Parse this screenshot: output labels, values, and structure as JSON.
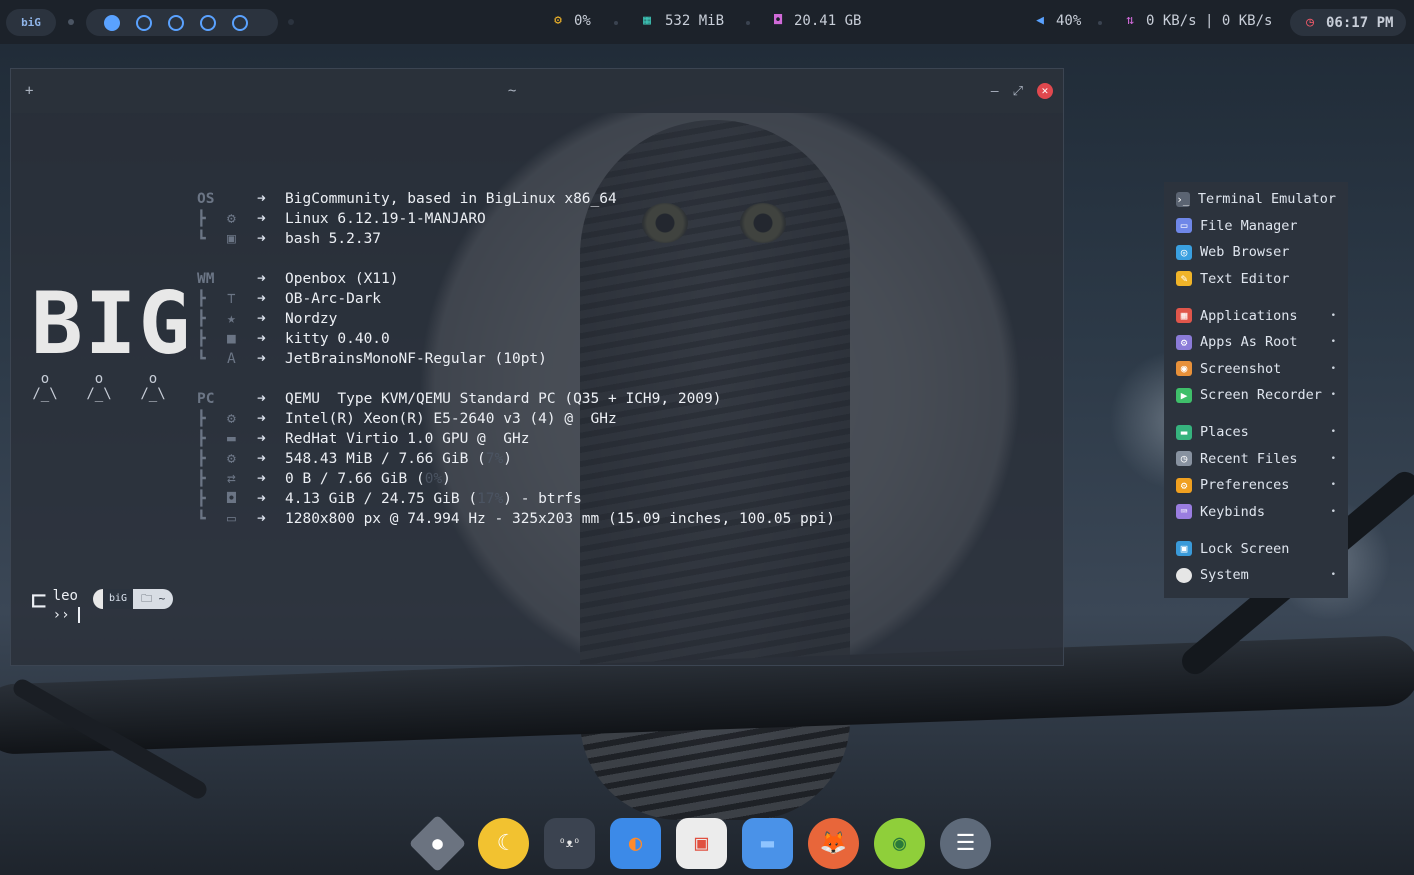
{
  "topbar": {
    "logo": "biG",
    "workspaces": 5,
    "active_workspace": 1,
    "cpu": "0%",
    "memory": "532 MiB",
    "disk": "20.41 GB",
    "volume": "40%",
    "network": "0 KB/s | 0 KB/s",
    "clock": "06:17 PM"
  },
  "terminal": {
    "title": "~",
    "new_tab": "+",
    "min": "–",
    "max": "⤢",
    "close": "✕",
    "logo": "BIG",
    "mini": [
      "o\n/_\\",
      "o\n/_\\",
      "o\n/_\\"
    ],
    "fastfetch": {
      "os_key": "OS",
      "wm_key": "WM",
      "pc_key": "PC",
      "os": "BigCommunity, based in BigLinux x86_64",
      "kernel": "Linux 6.12.19-1-MANJARO",
      "shell": "bash 5.2.37",
      "wm": "Openbox (X11)",
      "theme": "OB-Arc-Dark",
      "icons": "Nordzy",
      "terminal": "kitty 0.40.0",
      "font": "JetBrainsMonoNF-Regular (10pt)",
      "host": "QEMU  Type KVM/QEMU Standard PC (Q35 + ICH9, 2009)",
      "cpu": "Intel(R) Xeon(R) E5-2640 v3 (4) @  GHz",
      "gpu": "RedHat Virtio 1.0 GPU @  GHz",
      "memory": "548.43 MiB / 7.66 GiB (",
      "memory_pct": "7%",
      "swap": "0 B / 7.66 GiB (",
      "swap_pct": "0%",
      "disk": "4.13 GiB / 24.75 GiB (",
      "disk_pct": "17%",
      "disk_fs": ") - btrfs",
      "display": "1280x800 px @ 74.994 Hz - 325x203 mm (15.09 inches, 100.05 ppi)"
    },
    "prompt_user": "leo",
    "prompt_arrow": "››",
    "prompt_logo": "biG",
    "prompt_dir": "🗀 ~"
  },
  "menu": {
    "items": [
      {
        "label": "Terminal Emulator",
        "icon": "terminal-icon",
        "color": "#5b6472",
        "submenu": false
      },
      {
        "label": "File Manager",
        "icon": "file-manager-icon",
        "color": "#6f87e8",
        "submenu": false
      },
      {
        "label": "Web Browser",
        "icon": "web-browser-icon",
        "color": "#3aa0e0",
        "submenu": false
      },
      {
        "label": "Text Editor",
        "icon": "text-editor-icon",
        "color": "#f0b429",
        "submenu": false
      },
      {
        "label": "Applications",
        "icon": "applications-icon",
        "color": "#e0564b",
        "submenu": true
      },
      {
        "label": "Apps As Root",
        "icon": "apps-as-root-icon",
        "color": "#8b7bd8",
        "submenu": true
      },
      {
        "label": "Screenshot",
        "icon": "screenshot-icon",
        "color": "#e8913a",
        "submenu": true
      },
      {
        "label": "Screen Recorder",
        "icon": "screen-recorder-icon",
        "color": "#3fbf6a",
        "submenu": true
      },
      {
        "label": "Places",
        "icon": "places-icon",
        "color": "#36b37e",
        "submenu": true
      },
      {
        "label": "Recent Files",
        "icon": "recent-files-icon",
        "color": "#8892a0",
        "submenu": true
      },
      {
        "label": "Preferences",
        "icon": "preferences-icon",
        "color": "#f0a020",
        "submenu": true
      },
      {
        "label": "Keybinds",
        "icon": "keybinds-icon",
        "color": "#9a7de0",
        "submenu": true
      },
      {
        "label": "Lock Screen",
        "icon": "lock-screen-icon",
        "color": "#3a9ad9",
        "submenu": false
      },
      {
        "label": "System",
        "icon": "system-icon",
        "color": "#e6e6e6",
        "submenu": true
      }
    ],
    "submenu_glyph": "•"
  },
  "dock": [
    {
      "name": "dock-settings-icon",
      "glyph": "●",
      "bg": "#6b7380",
      "fg": "#ffffff"
    },
    {
      "name": "dock-lamp-icon",
      "glyph": "☾",
      "bg": "#f2c230",
      "fg": "#ffffff"
    },
    {
      "name": "dock-cat-terminal-icon",
      "glyph": "ᴼᴥᴼ",
      "bg": "#3b4350",
      "fg": "#e8e8e8"
    },
    {
      "name": "dock-browser-icon",
      "glyph": "◐",
      "bg": "#3c8ae8",
      "fg": "#ff8a2a"
    },
    {
      "name": "dock-image-viewer-icon",
      "glyph": "▣",
      "bg": "#ececec",
      "fg": "#e05040"
    },
    {
      "name": "dock-folder-icon",
      "glyph": "▬",
      "bg": "#4a92e8",
      "fg": "#8fc4ff"
    },
    {
      "name": "dock-fox-icon",
      "glyph": "🦊",
      "bg": "#e8663a",
      "fg": "#ffffff"
    },
    {
      "name": "dock-music-icon",
      "glyph": "◉",
      "bg": "#8fcf3a",
      "fg": "#2a7a3a"
    },
    {
      "name": "dock-mixer-icon",
      "glyph": "☰",
      "bg": "#5e6a7a",
      "fg": "#ffffff"
    }
  ]
}
